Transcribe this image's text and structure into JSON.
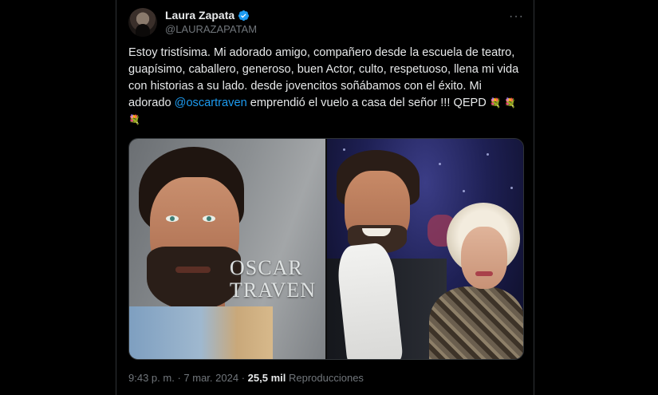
{
  "author": {
    "display_name": "Laura Zapata",
    "handle": "@LAURAZAPATAM",
    "verified_color": "#1d9bf0"
  },
  "more_icon": "···",
  "tweet": {
    "text_before_mention": "Estoy tristísima. Mi adorado amigo, compañero desde la escuela de teatro, guapísimo, caballero, generoso, buen Actor, culto, respetuoso, llena mi vida con historias a su lado. desde jovencitos soñábamos con el éxito. Mi adorado ",
    "mention": "@oscartraven",
    "text_after_mention": " emprendió el vuelo a casa del señor !!! QEPD ",
    "emojis": "💐 💐 💐"
  },
  "media": {
    "left_cover_text_line1": "OSCAR",
    "left_cover_text_line2": "TRAVEN"
  },
  "meta": {
    "time": "9:43 p. m.",
    "separator": "·",
    "date": "7 mar. 2024",
    "separator2": "·",
    "views_count": "25,5 mil",
    "views_label": "Reproducciones"
  },
  "colors": {
    "link": "#1d9bf0",
    "muted": "#71767b",
    "text": "#e7e9ea",
    "background": "#000000"
  }
}
